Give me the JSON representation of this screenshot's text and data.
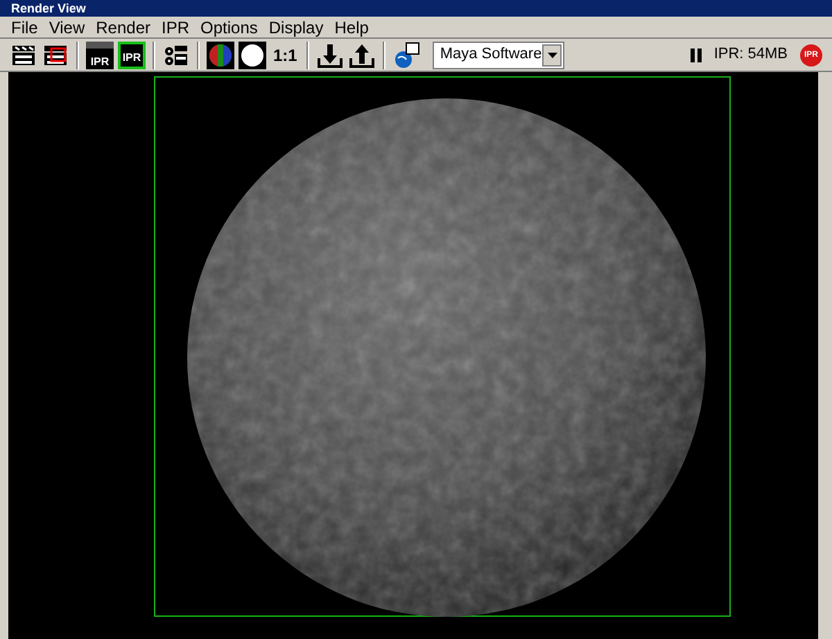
{
  "window": {
    "title": "Render View"
  },
  "menu": [
    "File",
    "View",
    "Render",
    "IPR",
    "Options",
    "Display",
    "Help"
  ],
  "toolbar": [
    {
      "kind": "clapboard"
    },
    {
      "kind": "clapboard-red"
    },
    {
      "kind": "sep"
    },
    {
      "kind": "clapboard-ipr",
      "label": "IPR"
    },
    {
      "kind": "ipr-green",
      "label": "IPR"
    },
    {
      "kind": "sep"
    },
    {
      "kind": "snapshot"
    },
    {
      "kind": "sep"
    },
    {
      "kind": "rgb"
    },
    {
      "kind": "alpha"
    },
    {
      "kind": "text",
      "label": "1:1"
    },
    {
      "kind": "sep"
    },
    {
      "kind": "keep"
    },
    {
      "kind": "remove"
    },
    {
      "kind": "sep"
    },
    {
      "kind": "globe"
    }
  ],
  "renderer": {
    "value": "Maya Software"
  },
  "status": {
    "paused": true,
    "text": "IPR: 54MB",
    "stop_label": "IPR"
  },
  "viewport": {
    "region_frame": true
  }
}
